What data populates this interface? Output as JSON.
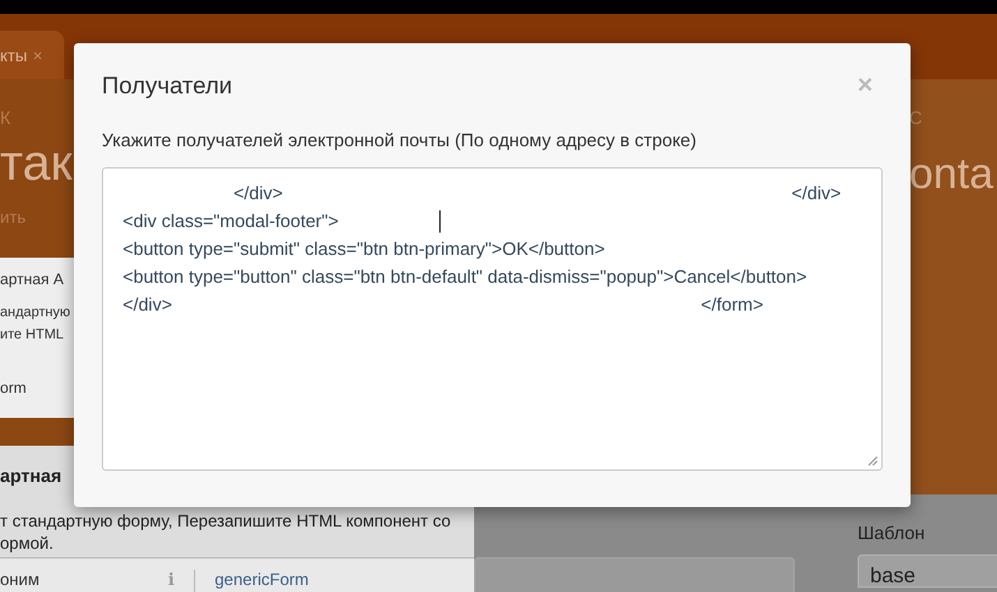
{
  "background_page": {
    "tab": {
      "label": "кты",
      "close": "×"
    },
    "left_header": {
      "breadcrumb": "К",
      "title": "так",
      "action": "ить"
    },
    "left_card": {
      "title": "артная А",
      "lines": [
        "андартную",
        "ите HTML"
      ],
      "footer": "orm"
    },
    "section": {
      "title": "артная",
      "description_lines": [
        "т стандартную форму, Перезапишите HTML компонент со",
        "ормой."
      ]
    },
    "table_row": {
      "column_1": "оним",
      "info": "i",
      "column_2": "genericForm"
    },
    "right_header": {
      "breadcrumb": "С",
      "title": "onta"
    },
    "template_field": {
      "label": "Шаблон",
      "value": "base"
    }
  },
  "modal": {
    "title": "Получатели",
    "close": "×",
    "instruction": "Укажите получателей электронной почты (По одному адресу в строке)",
    "textarea_lines": [
      {
        "text": "                      </div>                                                                                                     </div>",
        "caret": false
      },
      {
        "text": "<div class=\"modal-footer\">                    ",
        "caret": true
      },
      {
        "text": "<button type=\"submit\" class=\"btn btn-primary\">OK</button>",
        "caret": false
      },
      {
        "text": "<button type=\"button\" class=\"btn btn-default\" data-dismiss=\"popup\">Cancel</button>",
        "caret": false
      },
      {
        "text": "</div>                                                                                                         </form>",
        "caret": false
      }
    ]
  }
}
